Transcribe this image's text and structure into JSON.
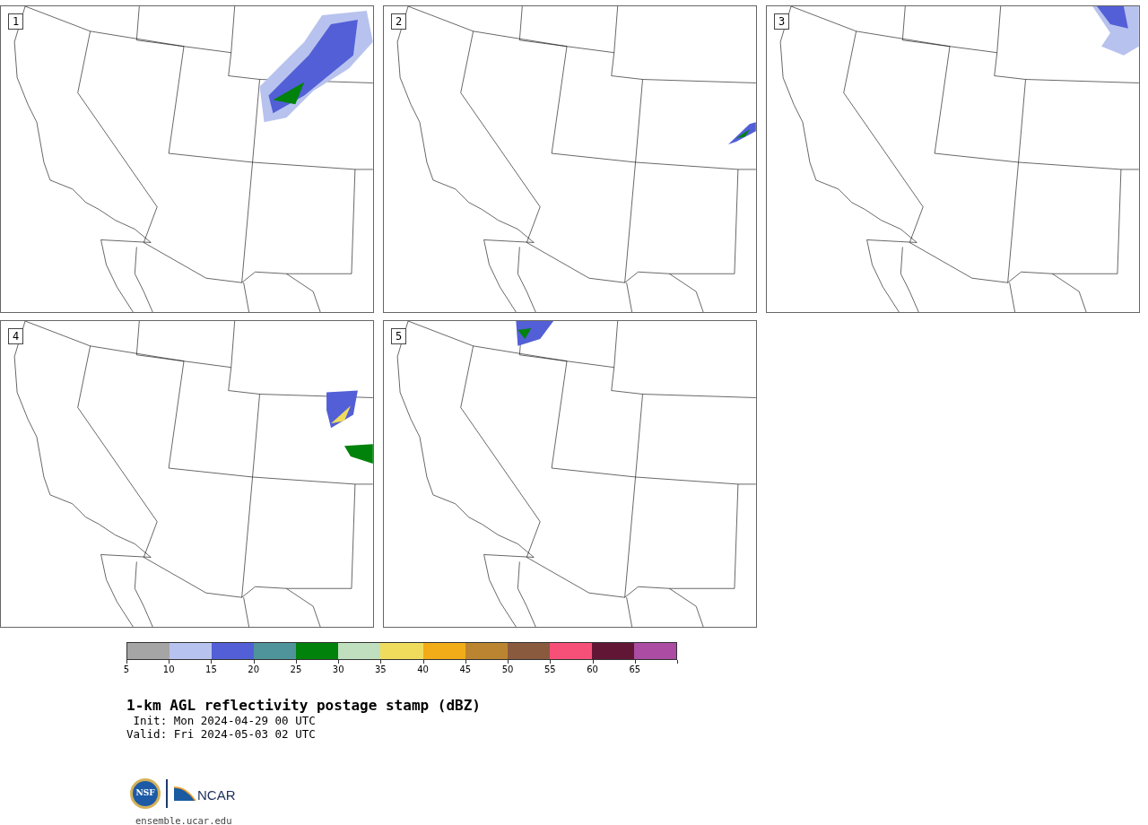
{
  "panels": [
    {
      "label": "1"
    },
    {
      "label": "2"
    },
    {
      "label": "3"
    },
    {
      "label": "4"
    },
    {
      "label": "5"
    }
  ],
  "colorbar": {
    "segments": [
      {
        "color": "#a5a5a5"
      },
      {
        "color": "#b8c2ee"
      },
      {
        "color": "#525fd6"
      },
      {
        "color": "#4f949b"
      },
      {
        "color": "#00820b"
      },
      {
        "color": "#bfdfbe"
      },
      {
        "color": "#f0dc5c"
      },
      {
        "color": "#f1ac18"
      },
      {
        "color": "#bb8431"
      },
      {
        "color": "#8a5a3e"
      },
      {
        "color": "#f65079"
      },
      {
        "color": "#611636"
      },
      {
        "color": "#ac4ca2"
      }
    ],
    "tick_labels": [
      "5",
      "10",
      "15",
      "20",
      "25",
      "30",
      "35",
      "40",
      "45",
      "50",
      "55",
      "60",
      "65"
    ]
  },
  "title": "1-km AGL reflectivity postage stamp (dBZ)",
  "init": " Init: Mon 2024-04-29 00 UTC",
  "valid": "Valid: Fri 2024-05-03 02 UTC",
  "logos": {
    "nsf": "NSF",
    "ncar": "NCAR"
  },
  "footer": "ensemble.ucar.edu"
}
